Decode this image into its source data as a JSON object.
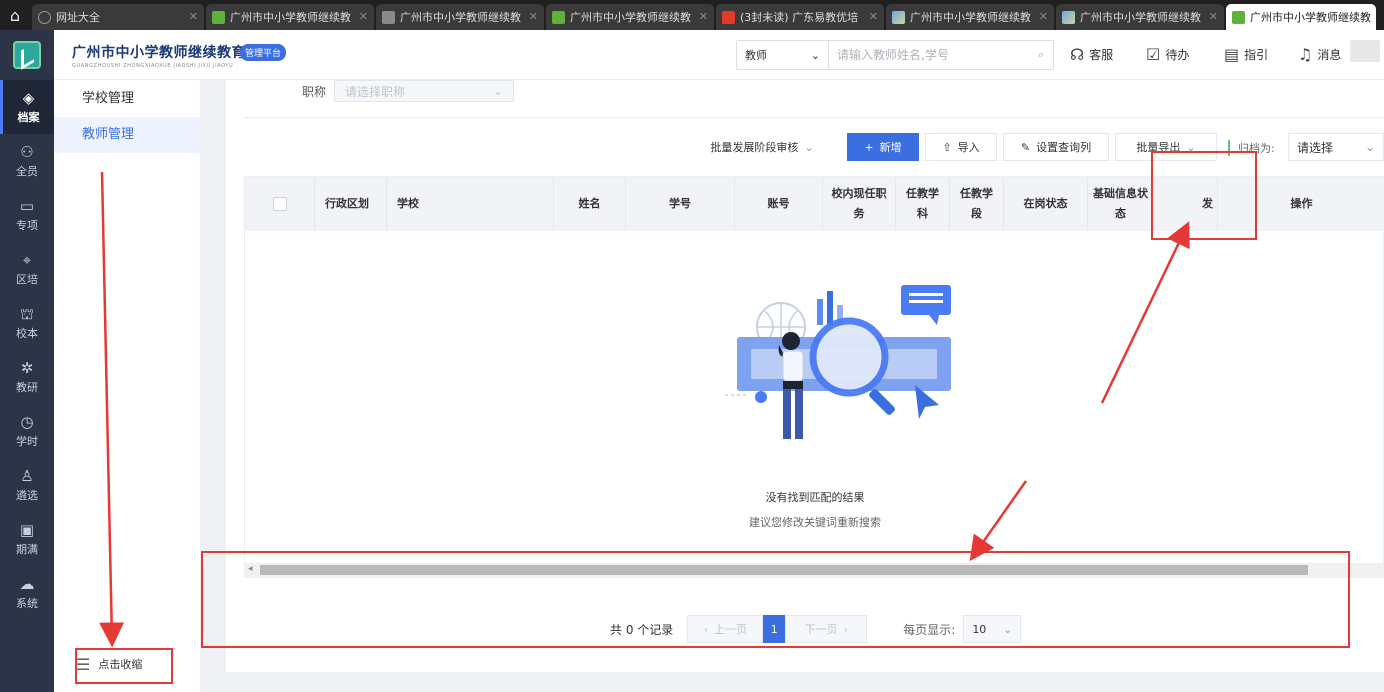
{
  "browser": {
    "tabs": [
      {
        "label": "网址大全",
        "icon": "globe-icon"
      },
      {
        "label": "广州市中小学教师继续教",
        "icon": "site-logo-icon"
      },
      {
        "label": "广州市中小学教师继续教",
        "icon": "page-icon"
      },
      {
        "label": "广州市中小学教师继续教",
        "icon": "site-logo-icon"
      },
      {
        "label": "(3封未读) 广东易教优培",
        "icon": "mail-icon"
      },
      {
        "label": "广州市中小学教师继续教",
        "icon": "photo-icon"
      },
      {
        "label": "广州市中小学教师继续教",
        "icon": "photo-icon"
      },
      {
        "label": "广州市中小学教师继续教",
        "icon": "site-logo-icon"
      }
    ]
  },
  "app": {
    "title": "广州市中小学教师继续教育网",
    "subtitle": "GUANGZHOUSHI ZHONGXIAOXUE JIAOSHI JIXU JIAOYU",
    "badge": "管理平台"
  },
  "leftnav": [
    {
      "label": "档案",
      "icon": "layers-icon",
      "active": true
    },
    {
      "label": "全员",
      "icon": "users-icon"
    },
    {
      "label": "专项",
      "icon": "briefcase-icon"
    },
    {
      "label": "区培",
      "icon": "map-pin-icon"
    },
    {
      "label": "校本",
      "icon": "school-icon"
    },
    {
      "label": "教研",
      "icon": "research-icon"
    },
    {
      "label": "学时",
      "icon": "clock-icon"
    },
    {
      "label": "遴选",
      "icon": "select-person-icon"
    },
    {
      "label": "期满",
      "icon": "calendar-check-icon"
    },
    {
      "label": "系统",
      "icon": "cloud-settings-icon"
    }
  ],
  "search": {
    "type": "教师",
    "placeholder": "请输入教师姓名,学号"
  },
  "header_links": {
    "service": "客服",
    "todo": "待办",
    "guide": "指引",
    "messages": "消息"
  },
  "subnav": {
    "items": [
      {
        "label": "学校管理"
      },
      {
        "label": "教师管理",
        "active": true
      }
    ],
    "collapse_label": "点击收缩"
  },
  "filter": {
    "label": "职称",
    "placeholder": "请选择职称"
  },
  "toolbar": {
    "batch_review": "批量发展阶段审核",
    "add": "新增",
    "import": "导入",
    "set_columns": "设置查询列",
    "batch_export": "批量导出",
    "archive_label": "归档为:",
    "archive_value": "请选择"
  },
  "table": {
    "columns": [
      "行政区划",
      "学校",
      "姓名",
      "学号",
      "账号",
      "校内现任职务",
      "任教学科",
      "任教学段",
      "在岗状态",
      "基础信息状态",
      "发",
      "操作"
    ],
    "empty_title": "没有找到匹配的结果",
    "empty_subtitle": "建议您修改关键词重新搜索"
  },
  "pagination": {
    "total_text": "共 0 个记录",
    "prev": "上一页",
    "current": "1",
    "next": "下一页",
    "page_size_label": "每页显示:",
    "page_size": "10"
  },
  "colors": {
    "primary": "#3b6fe0",
    "nav_bg": "#2c3547",
    "annotation": "#e53935"
  }
}
